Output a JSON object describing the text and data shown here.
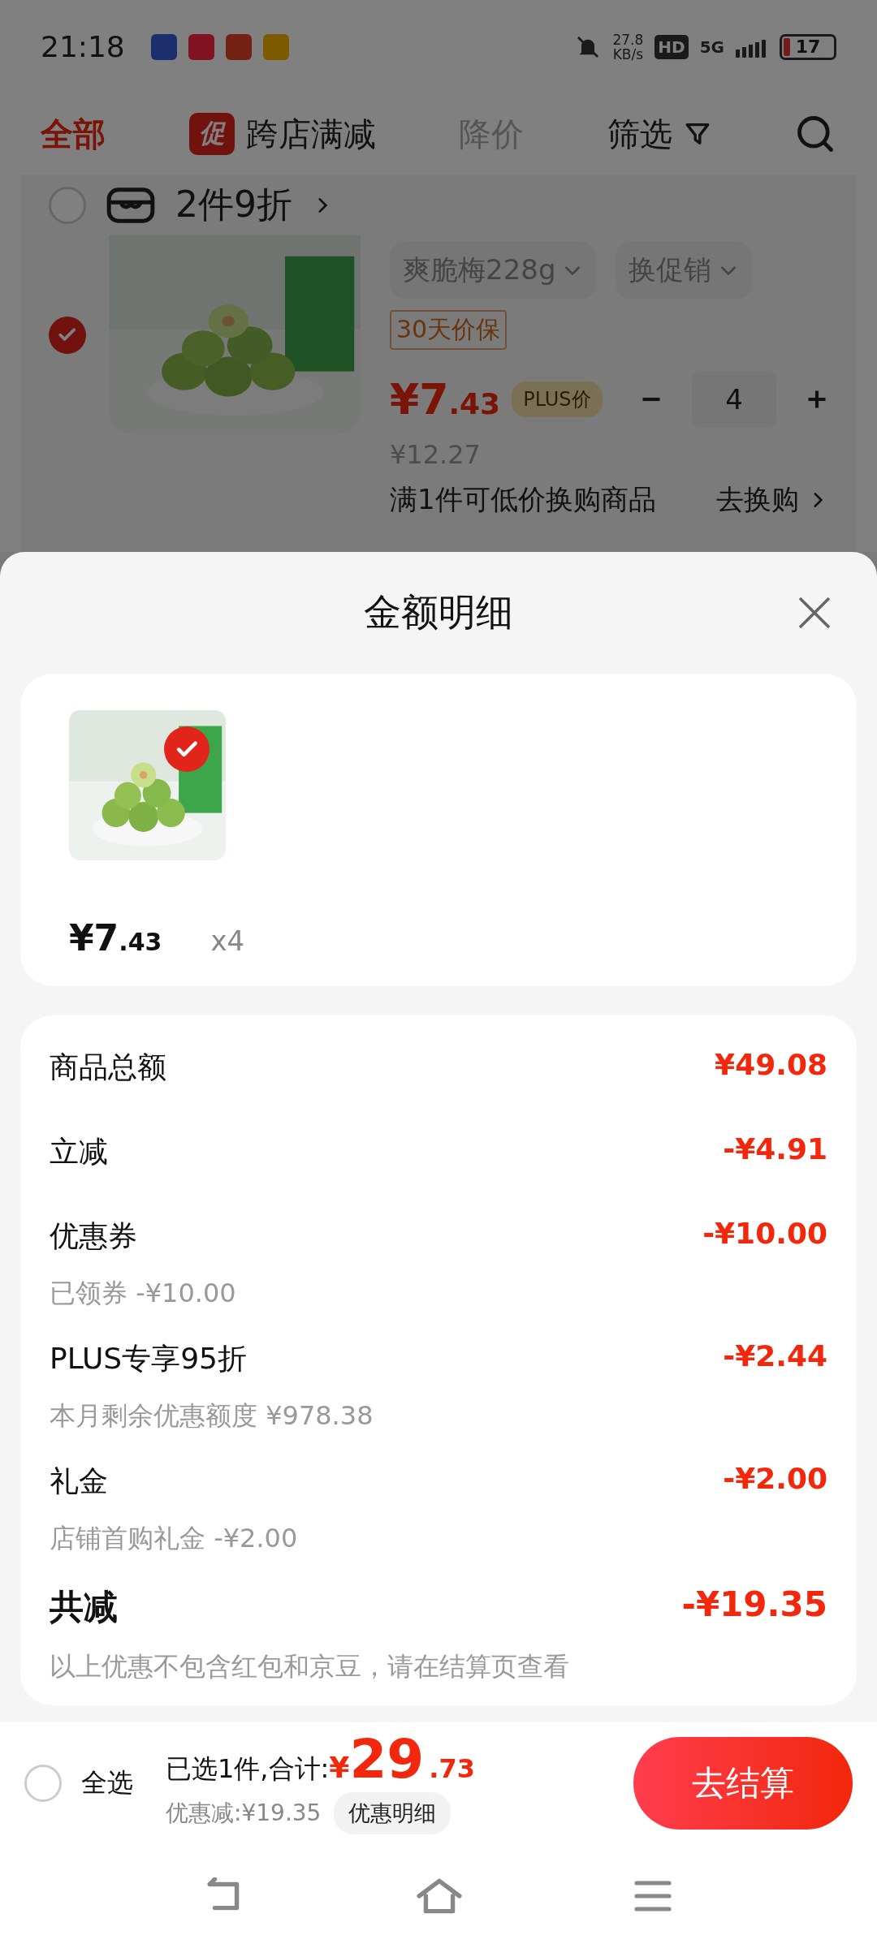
{
  "status_bar": {
    "time": "21:18",
    "net_speed": "27.8",
    "net_unit": "KB/s",
    "hd": "HD",
    "network": "5G",
    "battery": "17"
  },
  "tabs": [
    {
      "label": "全部",
      "selected": true,
      "dimmed": false
    },
    {
      "label": "跨店满减",
      "badge": "促",
      "selected": false,
      "dimmed": false
    },
    {
      "label": "降价",
      "selected": false,
      "dimmed": true
    },
    {
      "label": "筛选",
      "selected": false,
      "dimmed": false
    }
  ],
  "cart_store": {
    "checked": false,
    "title": "2件9折",
    "item": {
      "checked": true,
      "variant": "爽脆梅228g",
      "promo_button": "换促销",
      "tag": "30天价保",
      "price_integer": "¥7",
      "price_decimal": ".43",
      "plus_label": "PLUS价",
      "quantity": "4",
      "original_price": "¥12.27",
      "swap_text": "满1件可低价换购商品",
      "swap_link": "去换购"
    }
  },
  "sheet": {
    "title": "金额明细",
    "product": {
      "checked": true,
      "price_integer": "¥7",
      "price_decimal": ".43",
      "quantity": "x4"
    },
    "details": [
      {
        "kind": "line",
        "label": "商品总额",
        "amount": "¥49.08"
      },
      {
        "kind": "line",
        "label": "立减",
        "amount": "-¥4.91"
      },
      {
        "kind": "line",
        "label": "优惠券",
        "sub": "已领券 -¥10.00",
        "amount": "-¥10.00"
      },
      {
        "kind": "line",
        "label": "PLUS专享95折",
        "sub": "本月剩余优惠额度 ¥978.38",
        "amount": "-¥2.44"
      },
      {
        "kind": "line",
        "label": "礼金",
        "sub": "店铺首购礼金 -¥2.00",
        "amount": "-¥2.00"
      },
      {
        "kind": "total",
        "label": "共减",
        "sub": "以上优惠不包含红包和京豆，请在结算页查看",
        "amount": "-¥19.35"
      }
    ]
  },
  "bottom_bar": {
    "select_all": {
      "label": "全选",
      "checked": false
    },
    "summary": "已选1件,合计:",
    "currency": "¥",
    "total_integer": "29",
    "total_decimal": ".73",
    "discount": "优惠减:¥19.35",
    "detail_button": "优惠明细",
    "checkout": "去结算"
  }
}
